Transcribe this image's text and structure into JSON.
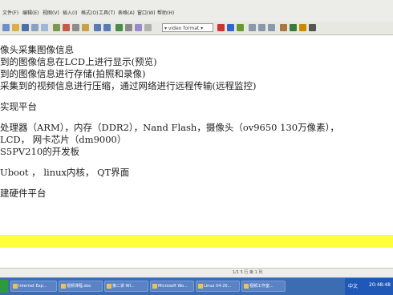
{
  "menu": [
    "文件(F)",
    "编辑(E)",
    "视图(V)",
    "插入(I)",
    "格式(O)",
    "工具(T)",
    "表格(A)",
    "窗口(W)",
    "帮助(H)"
  ],
  "toolbar": {
    "style_value": "▾ video format ▾"
  },
  "document": {
    "lines": [
      "像头采集图像信息",
      "到的图像信息在LCD上进行显示(预览)",
      "到的图像信息进行存储(拍照和录像)",
      "采集到的视频信息进行压缩，通过网络进行远程传输(远程监控)",
      "",
      "实现平台",
      "",
      "处理器（ARM），内存（DDR2），Nand Flash，摄像头（ov9650 130万像素），",
      "LCD，  网卡芯片（dm9000）",
      "S5PV210的开发板",
      "",
      "Uboot ， linux内核， QT界面",
      "",
      "建硬件平台"
    ]
  },
  "status_bar": {
    "position": "1/1  5 行  第 1 列"
  },
  "taskbar": {
    "tasks": [
      "Internet Exp...",
      "视频课程.doc",
      "第二讲 WI...",
      "Microsoft Wo...",
      "Linux 04-20...",
      "视频工作室..."
    ],
    "clock": "20:48:48",
    "tray_label": "中文"
  },
  "colors": {
    "highlight": "#ffff3a",
    "taskbar": "#3c6cb2"
  }
}
